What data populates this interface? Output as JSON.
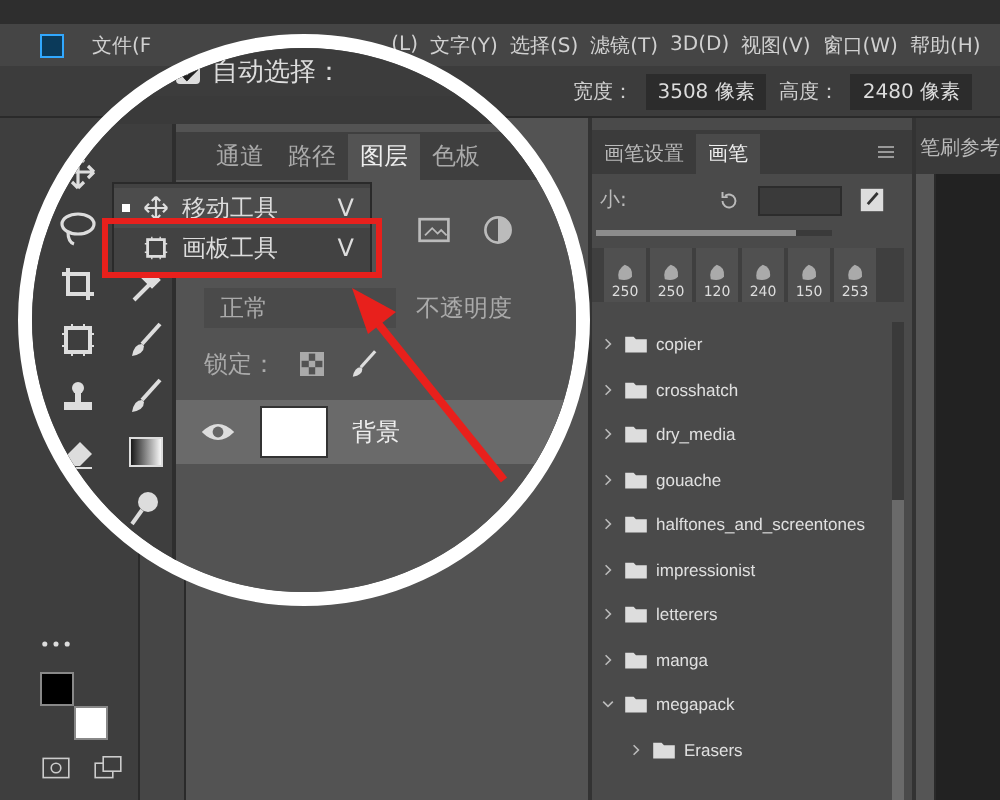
{
  "menu_bar": {
    "items": [
      "文件(F",
      "(L)",
      "文字(Y)",
      "选择(S)",
      "滤镜(T)",
      "3D(D)",
      "视图(V)",
      "窗口(W)",
      "帮助(H)"
    ]
  },
  "options_bar": {
    "auto_select": {
      "label": "自动选择：",
      "checked": true
    },
    "width": {
      "label": "宽度：",
      "value": "3508 像素"
    },
    "height": {
      "label": "高度：",
      "value": "2480 像素"
    }
  },
  "magnifier": {
    "panel_tabs": [
      {
        "label": "通道",
        "selected": false
      },
      {
        "label": "路径",
        "selected": false
      },
      {
        "label": "图层",
        "selected": true
      },
      {
        "label": "色板",
        "selected": false
      }
    ],
    "tool_flyout": [
      {
        "label": "移动工具",
        "shortcut": "V",
        "selected": true
      },
      {
        "label": "画板工具",
        "shortcut": "V",
        "selected": false
      }
    ],
    "blend_mode": "正常",
    "opacity_label": "不透明度",
    "lock_label": "锁定：",
    "layers": [
      {
        "name": "背景",
        "visible": true
      }
    ]
  },
  "brush_panel": {
    "tabs": [
      {
        "label": "画笔设置",
        "selected": false
      },
      {
        "label": "画笔",
        "selected": true
      }
    ],
    "size_label": "小:",
    "size_slider": {
      "level": 0.85
    },
    "presets": [
      "250",
      "250",
      "120",
      "240",
      "150",
      "253"
    ],
    "folders": [
      {
        "name": "copier",
        "expanded": false
      },
      {
        "name": "crosshatch",
        "expanded": false
      },
      {
        "name": "dry_media",
        "expanded": false
      },
      {
        "name": "gouache",
        "expanded": false
      },
      {
        "name": "halftones_and_screentones",
        "expanded": false
      },
      {
        "name": "impressionist",
        "expanded": false
      },
      {
        "name": "letterers",
        "expanded": false
      },
      {
        "name": "manga",
        "expanded": false
      },
      {
        "name": "megapack",
        "expanded": true,
        "children": [
          {
            "name": "Erasers",
            "expanded": false
          }
        ]
      }
    ]
  },
  "document_panel": {
    "tab": "笔刷参考"
  }
}
